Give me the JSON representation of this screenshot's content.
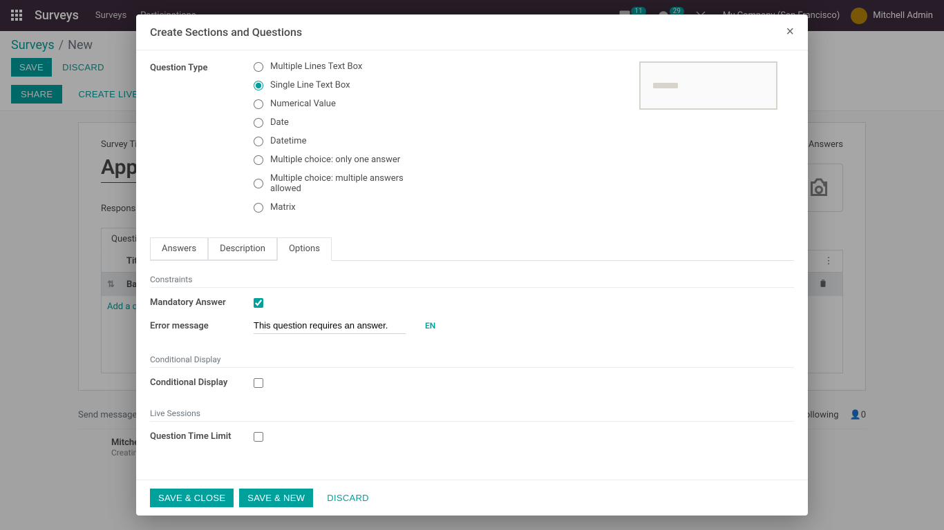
{
  "nav": {
    "brand": "Surveys",
    "menu": [
      "Surveys",
      "Participations"
    ],
    "badge1": "11",
    "badge2": "29",
    "company": "My Company (San Francisco)",
    "user": "Mitchell Admin"
  },
  "breadcrumb": {
    "root": "Surveys",
    "current": "New"
  },
  "buttons": {
    "save": "Save",
    "discard": "Discard",
    "share": "Share",
    "create_live": "Create Live Session"
  },
  "form": {
    "survey_title_label": "Survey Title",
    "survey_title_value": "App",
    "responsible_label": "Responsible",
    "tab_questions": "Questions",
    "col_title": "Title",
    "row_basic": "Basic Information",
    "add_question": "Add a question",
    "answers_stat": "Answers"
  },
  "chatter": {
    "send_message": "Send message",
    "following": "Following",
    "followers": "0",
    "author": "Mitchell Admin",
    "subtitle": "Creating a new record..."
  },
  "modal": {
    "title": "Create Sections and Questions",
    "qtype_label": "Question Type",
    "qtypes": [
      "Multiple Lines Text Box",
      "Single Line Text Box",
      "Numerical Value",
      "Date",
      "Datetime",
      "Multiple choice: only one answer",
      "Multiple choice: multiple answers allowed",
      "Matrix"
    ],
    "qtype_selected": 1,
    "tabs": {
      "answers": "Answers",
      "description": "Description",
      "options": "Options"
    },
    "sections": {
      "constraints": "Constraints",
      "mandatory": "Mandatory Answer",
      "mandatory_checked": true,
      "error_label": "Error message",
      "error_value": "This question requires an answer.",
      "lang": "EN",
      "conditional_title": "Conditional Display",
      "conditional_label": "Conditional Display",
      "conditional_checked": false,
      "live_title": "Live Sessions",
      "qtime_label": "Question Time Limit",
      "qtime_checked": false
    },
    "footer": {
      "save_close": "Save & Close",
      "save_new": "Save & New",
      "discard": "Discard"
    }
  }
}
